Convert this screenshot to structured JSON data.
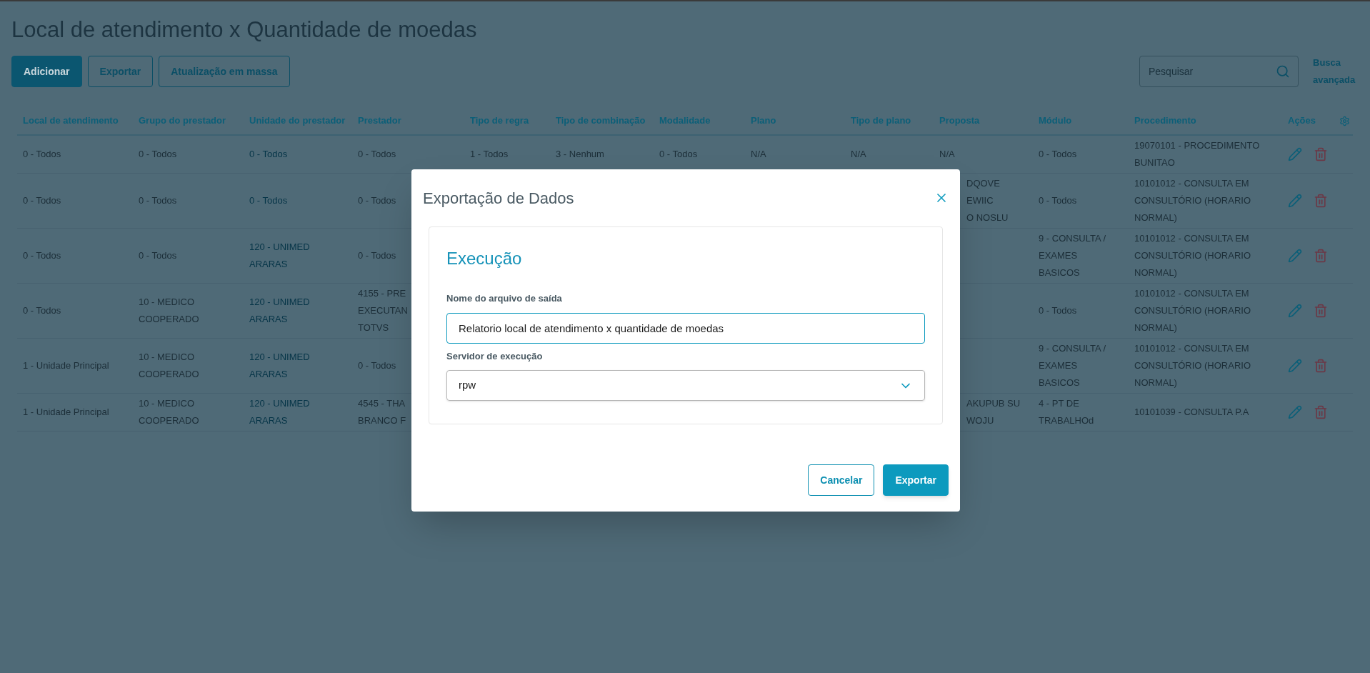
{
  "page": {
    "title": "Local de atendimento x Quantidade de moedas"
  },
  "toolbar": {
    "buttons": [
      {
        "label": "Adicionar",
        "kind": "primary"
      },
      {
        "label": "Exportar",
        "kind": "outline"
      },
      {
        "label": "Atualização em massa",
        "kind": "outline"
      }
    ],
    "search": {
      "placeholder": "Pesquisar"
    },
    "advanced_search": "Busca avançada"
  },
  "table": {
    "columns": [
      {
        "label": "Local de atendimento",
        "kind": "text"
      },
      {
        "label": "Grupo do prestador",
        "kind": "text"
      },
      {
        "label": "Unidade do prestador",
        "kind": "link"
      },
      {
        "label": "Prestador",
        "kind": "text"
      },
      {
        "label": "Tipo de regra",
        "kind": "text"
      },
      {
        "label": "Tipo de combinação",
        "kind": "text"
      },
      {
        "label": "Modalidade",
        "kind": "text"
      },
      {
        "label": "Plano",
        "kind": "text"
      },
      {
        "label": "Tipo de plano",
        "kind": "text"
      },
      {
        "label": "Proposta",
        "kind": "text"
      },
      {
        "label": "Módulo",
        "kind": "text"
      },
      {
        "label": "Procedimento",
        "kind": "text"
      },
      {
        "label": "Ações",
        "kind": "actions"
      }
    ],
    "rows": [
      {
        "cells": [
          "0 - Todos",
          "0 - Todos",
          "0 - Todos",
          "0 - Todos",
          "1 - Todos",
          "3 - Nenhum",
          "0 - Todos",
          "N/A",
          "N/A",
          "N/A",
          "0 - Todos",
          "19070101 - PROCEDIMENTO BUNITAO"
        ]
      },
      {
        "cells": [
          "0 - Todos",
          "0 - Todos",
          "0 - Todos",
          "0 - Todos",
          null,
          null,
          null,
          null,
          null,
          {
            "lines": [
              "DQOVE",
              "EWIIC",
              "O NOSLU"
            ]
          },
          "0 - Todos",
          "10101012 - CONSULTA EM CONSULTÓRIO (HORARIO NORMAL)"
        ]
      },
      {
        "cells": [
          "0 - Todos",
          "0 - Todos",
          "120 - UNIMED ARARAS",
          "0 - Todos",
          null,
          null,
          null,
          null,
          null,
          null,
          "9 - CONSULTA / EXAMES BASICOS",
          "10101012 - CONSULTA EM CONSULTÓRIO (HORARIO NORMAL)"
        ]
      },
      {
        "cells": [
          "0 - Todos",
          "10 - MEDICO COOPERADO",
          "120 - UNIMED ARARAS",
          {
            "lines": [
              "4155 - PRE",
              "EXECUTAN",
              "TOTVS"
            ]
          },
          null,
          null,
          null,
          null,
          null,
          null,
          "0 - Todos",
          "10101012 - CONSULTA EM CONSULTÓRIO (HORARIO NORMAL)"
        ]
      },
      {
        "cells": [
          "1 - Unidade Principal",
          "10 - MEDICO COOPERADO",
          "120 - UNIMED ARARAS",
          "0 - Todos",
          null,
          null,
          null,
          null,
          null,
          null,
          "9 - CONSULTA / EXAMES BASICOS",
          "10101012 - CONSULTA EM CONSULTÓRIO (HORARIO NORMAL)"
        ]
      },
      {
        "cells": [
          "1 - Unidade Principal",
          "10 - MEDICO COOPERADO",
          "120 - UNIMED ARARAS",
          {
            "lines": [
              "4545 - THA",
              "BRANCO F"
            ]
          },
          null,
          null,
          null,
          null,
          null,
          {
            "lines": [
              "AKUPUB SU",
              "WOJU"
            ]
          },
          "4 - PT DE TRABALHOd",
          "10101039 - CONSULTA P.A"
        ]
      }
    ]
  },
  "modal": {
    "title": "Exportação de Dados",
    "section_title": "Execução",
    "fields": [
      {
        "label": "Nome do arquivo de saída",
        "value": "Relatorio local de atendimento x quantidade de moedas",
        "kind": "text"
      },
      {
        "label": "Servidor de execução",
        "value": "rpw",
        "kind": "select"
      }
    ],
    "buttons": [
      {
        "label": "Cancelar",
        "kind": "outline"
      },
      {
        "label": "Exportar",
        "kind": "primary"
      }
    ]
  }
}
